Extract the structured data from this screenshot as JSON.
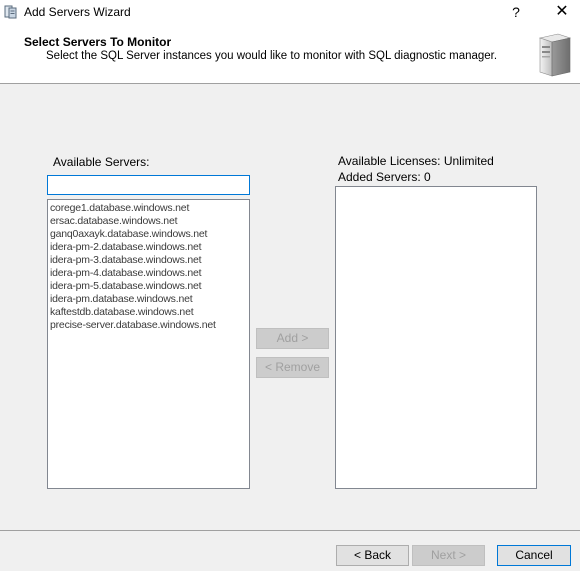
{
  "window": {
    "title": "Add Servers Wizard",
    "help_label": "?",
    "close_label": "✕"
  },
  "header": {
    "title": "Select Servers To Monitor",
    "subtitle": "Select the SQL Server instances you would like to monitor with SQL diagnostic manager."
  },
  "available": {
    "label": "Available Servers:",
    "search_value": "",
    "items": [
      "corege1.database.windows.net",
      "ersac.database.windows.net",
      "ganq0axayk.database.windows.net",
      "idera-pm-2.database.windows.net",
      "idera-pm-3.database.windows.net",
      "idera-pm-4.database.windows.net",
      "idera-pm-5.database.windows.net",
      "idera-pm.database.windows.net",
      "kaftestdb.database.windows.net",
      "precise-server.database.windows.net"
    ]
  },
  "added": {
    "licenses_label": "Available Licenses: Unlimited",
    "added_label": "Added Servers: 0",
    "items": []
  },
  "actions": {
    "add_label": "Add >",
    "remove_label": "< Remove"
  },
  "footer": {
    "back_label": "< Back",
    "next_label": "Next >",
    "cancel_label": "Cancel"
  },
  "icons": {
    "app": "wizard-server-icon",
    "header": "server-tower-icon"
  }
}
